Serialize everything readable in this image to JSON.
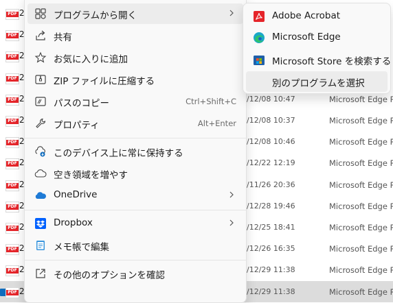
{
  "file_list": {
    "rows": [
      {
        "lead": "2",
        "date": "",
        "type": ""
      },
      {
        "lead": "2",
        "date": "",
        "type": ""
      },
      {
        "lead": "2",
        "date": "",
        "type": ""
      },
      {
        "lead": "2",
        "date": "",
        "type": ""
      },
      {
        "lead": "2",
        "date": "/12/08 10:47",
        "type": "Microsoft Edge P..."
      },
      {
        "lead": "2",
        "date": "/12/08 10:37",
        "type": "Microsoft Edge P..."
      },
      {
        "lead": "2",
        "date": "/12/08 10:46",
        "type": "Microsoft Edge P..."
      },
      {
        "lead": "2",
        "date": "/12/22 12:19",
        "type": "Microsoft Edge P..."
      },
      {
        "lead": "2",
        "date": "/11/26 20:36",
        "type": "Microsoft Edge P..."
      },
      {
        "lead": "2",
        "date": "/12/28 19:46",
        "type": "Microsoft Edge P..."
      },
      {
        "lead": "2",
        "date": "/12/25 18:41",
        "type": "Microsoft Edge P..."
      },
      {
        "lead": "2",
        "date": "/12/26 16:35",
        "type": "Microsoft Edge P..."
      },
      {
        "lead": "2",
        "date": "/12/29 11:38",
        "type": "Microsoft Edge P..."
      },
      {
        "lead": "2",
        "date": "/12/29 11:38",
        "type": "Microsoft Edge P..."
      }
    ]
  },
  "context_menu": {
    "open_with": "プログラムから開く",
    "share": "共有",
    "add_favorite": "お気に入りに追加",
    "compress_zip": "ZIP ファイルに圧縮する",
    "copy_path": "パスのコピー",
    "copy_path_shortcut": "Ctrl+Shift+C",
    "properties": "プロパティ",
    "properties_shortcut": "Alt+Enter",
    "always_keep": "このデバイス上に常に保持する",
    "free_space": "空き領域を増やす",
    "onedrive": "OneDrive",
    "dropbox": "Dropbox",
    "notepad_edit": "メモ帳で編集",
    "more_options": "その他のオプションを確認"
  },
  "submenu": {
    "acrobat": "Adobe Acrobat",
    "edge": "Microsoft Edge",
    "store": "Microsoft Store を検索する",
    "choose_other": "別のプログラムを選択"
  },
  "colors": {
    "pdf_red": "#e5252a",
    "accent_blue": "#0f6cbd",
    "onedrive_blue": "#1f7bd6",
    "dropbox_blue": "#0061fe",
    "hover_bg": "#ececec"
  }
}
